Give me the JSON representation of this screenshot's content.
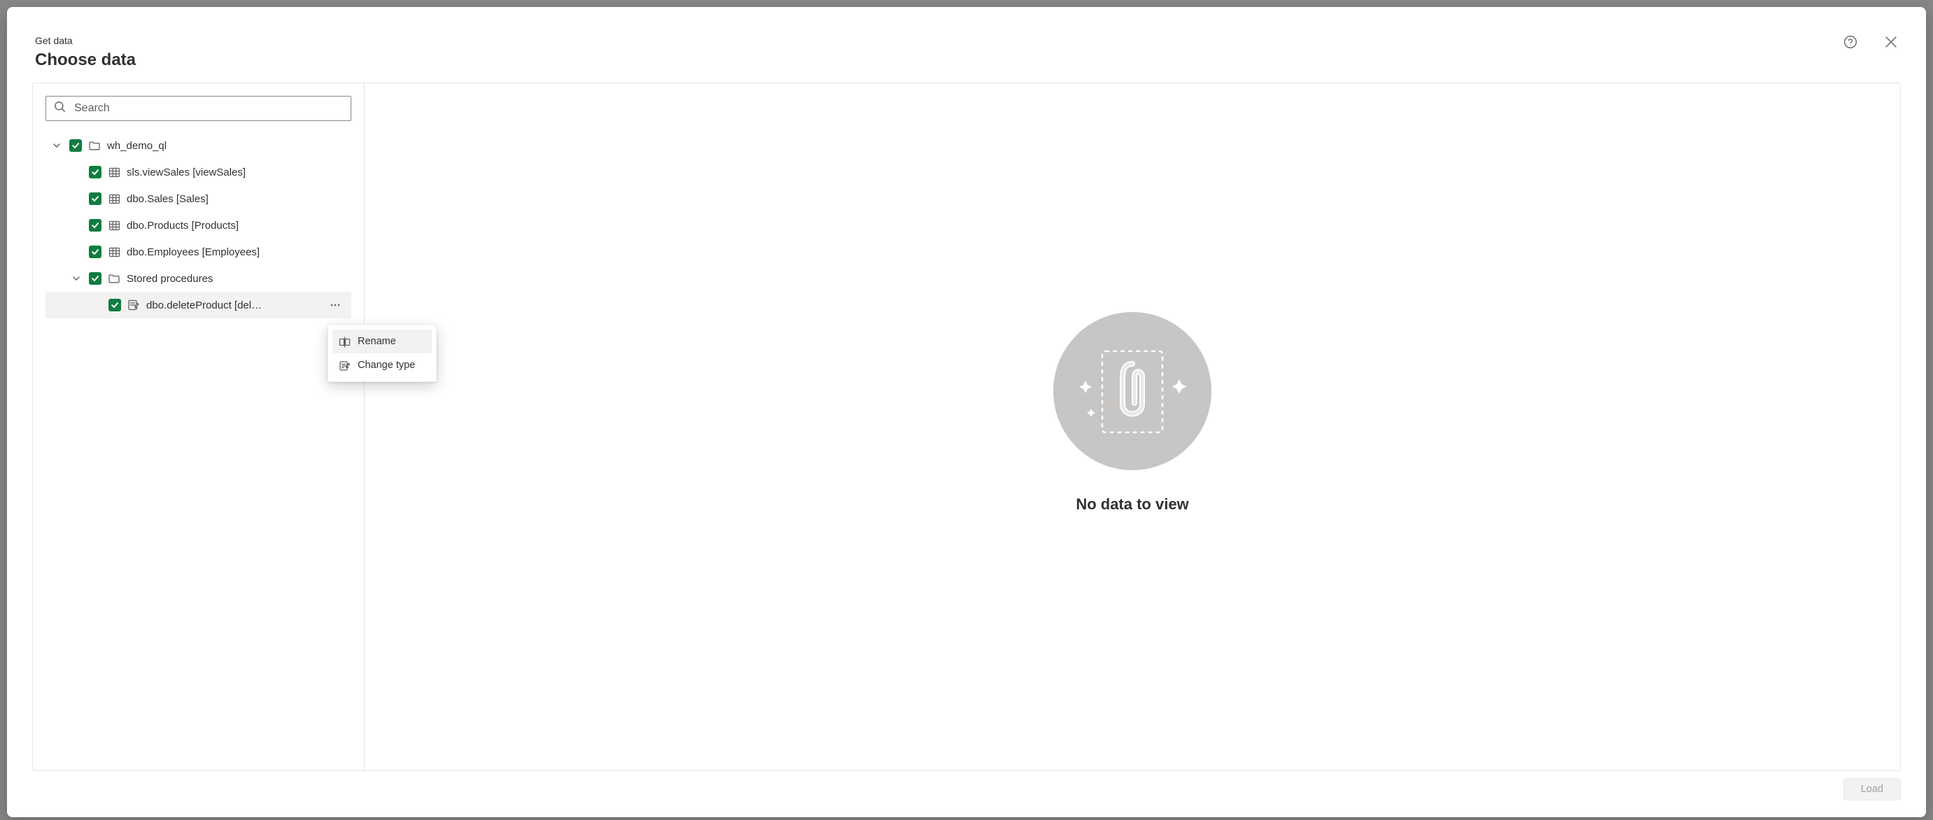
{
  "header": {
    "breadcrumb": "Get data",
    "title": "Choose data"
  },
  "search": {
    "placeholder": "Search"
  },
  "tree": {
    "root": {
      "label": "wh_demo_ql"
    },
    "items": [
      {
        "label": "sls.viewSales [viewSales]"
      },
      {
        "label": "dbo.Sales [Sales]"
      },
      {
        "label": "dbo.Products [Products]"
      },
      {
        "label": "dbo.Employees [Employees]"
      }
    ],
    "procFolder": {
      "label": "Stored procedures"
    },
    "procs": [
      {
        "label": "dbo.deleteProduct [del…"
      }
    ]
  },
  "contextMenu": {
    "rename": "Rename",
    "changeType": "Change type"
  },
  "rightPanel": {
    "emptyText": "No data to view"
  },
  "footer": {
    "loadLabel": "Load"
  }
}
